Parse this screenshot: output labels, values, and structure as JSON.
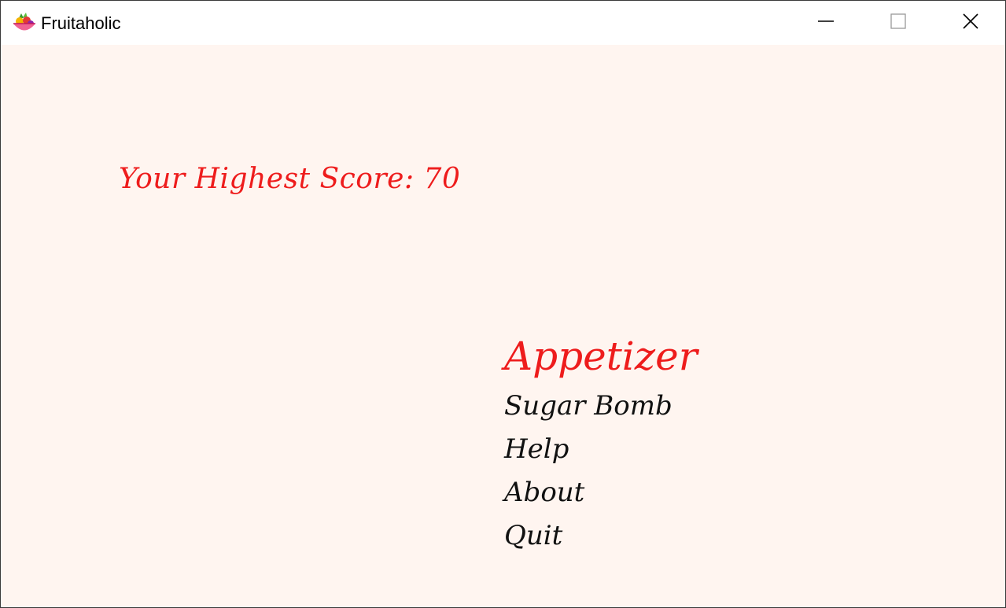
{
  "window": {
    "title": "Fruitaholic",
    "icon": "fruit-bowl-icon",
    "controls": {
      "minimize": "minimize-icon",
      "maximize": "maximize-icon",
      "close": "close-icon"
    }
  },
  "game": {
    "highest_score_text": "Your Highest Score: 70",
    "menu": {
      "items": [
        {
          "label": "Appetizer",
          "selected": true
        },
        {
          "label": "Sugar Bomb",
          "selected": false
        },
        {
          "label": "Help",
          "selected": false
        },
        {
          "label": "About",
          "selected": false
        },
        {
          "label": "Quit",
          "selected": false
        }
      ]
    }
  },
  "colors": {
    "background": "#fff5f0",
    "accent": "#ee1c1c",
    "menu_text": "#111111"
  }
}
